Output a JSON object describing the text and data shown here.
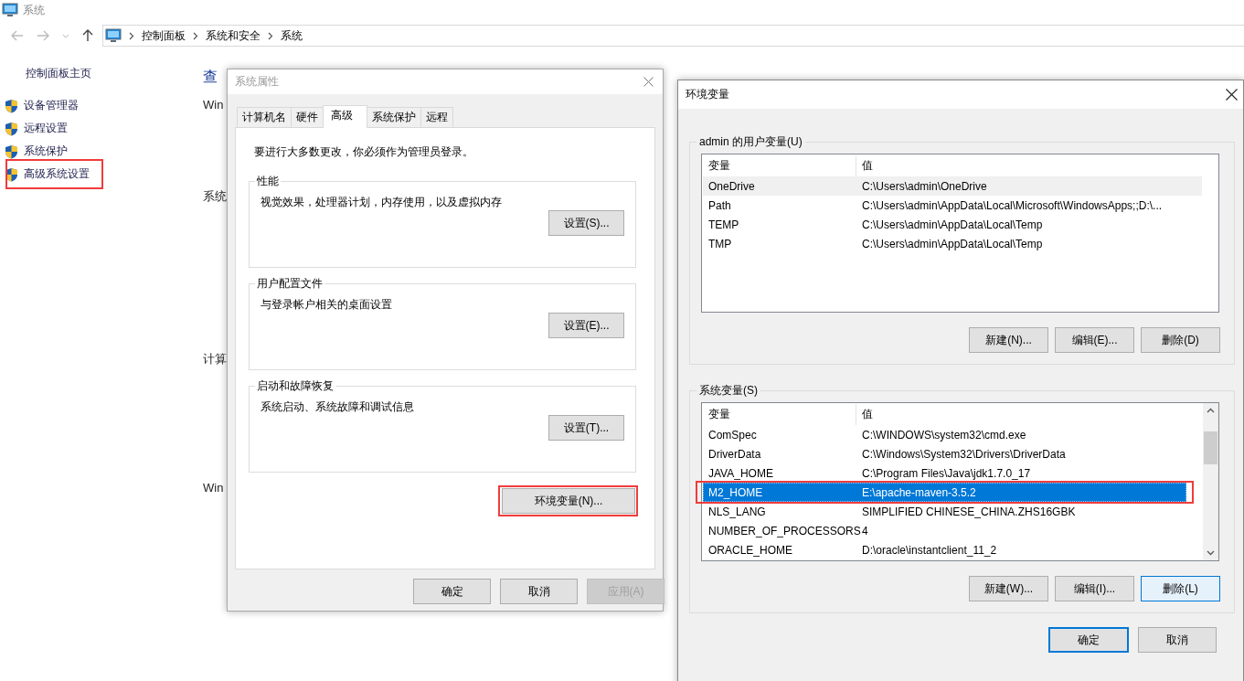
{
  "explorer": {
    "title": "系统",
    "breadcrumb": [
      "控制面板",
      "系统和安全",
      "系统"
    ],
    "sidebar": {
      "home": "控制面板主页",
      "items": [
        {
          "label": "设备管理器",
          "highlighted": false
        },
        {
          "label": "远程设置",
          "highlighted": false
        },
        {
          "label": "系统保护",
          "highlighted": false
        },
        {
          "label": "高级系统设置",
          "highlighted": true
        }
      ]
    },
    "content": [
      {
        "text": "查",
        "kind": "heading"
      },
      {
        "text": "Win",
        "kind": "section"
      },
      {
        "text": "系统",
        "kind": "section"
      },
      {
        "text": "计算",
        "kind": "section"
      },
      {
        "text": "Win",
        "kind": "section"
      }
    ]
  },
  "system_properties": {
    "title": "系统属性",
    "tabs": [
      {
        "label": "计算机名",
        "selected": false
      },
      {
        "label": "硬件",
        "selected": false
      },
      {
        "label": "高级",
        "selected": true
      },
      {
        "label": "系统保护",
        "selected": false
      },
      {
        "label": "远程",
        "selected": false
      }
    ],
    "notice": "要进行大多数更改，你必须作为管理员登录。",
    "groups": [
      {
        "title": "性能",
        "description": "视觉效果，处理器计划，内存使用，以及虚拟内存",
        "button": "设置(S)..."
      },
      {
        "title": "用户配置文件",
        "description": "与登录帐户相关的桌面设置",
        "button": "设置(E)..."
      },
      {
        "title": "启动和故障恢复",
        "description": "系统启动、系统故障和调试信息",
        "button": "设置(T)..."
      }
    ],
    "env_button": {
      "label": "环境变量(N)...",
      "highlighted": true
    },
    "buttons": [
      {
        "label": "确定",
        "disabled": false
      },
      {
        "label": "取消",
        "disabled": false
      },
      {
        "label": "应用(A)",
        "disabled": true
      }
    ]
  },
  "environment_variables": {
    "title": "环境变量",
    "lists": [
      {
        "title": "admin 的用户变量(U)",
        "focused": false,
        "scrollbar": false,
        "columns": [
          "变量",
          "值"
        ],
        "rows": [
          {
            "name": "OneDrive",
            "value": "C:\\Users\\admin\\OneDrive",
            "selected": true,
            "highlighted": false
          },
          {
            "name": "Path",
            "value": "C:\\Users\\admin\\AppData\\Local\\Microsoft\\WindowsApps;;D:\\...",
            "selected": false,
            "highlighted": false
          },
          {
            "name": "TEMP",
            "value": "C:\\Users\\admin\\AppData\\Local\\Temp",
            "selected": false,
            "highlighted": false
          },
          {
            "name": "TMP",
            "value": "C:\\Users\\admin\\AppData\\Local\\Temp",
            "selected": false,
            "highlighted": false
          }
        ],
        "buttons": [
          {
            "label": "新建(N)...",
            "hovered": false
          },
          {
            "label": "编辑(E)...",
            "hovered": false
          },
          {
            "label": "删除(D)",
            "hovered": false
          }
        ]
      },
      {
        "title": "系统变量(S)",
        "focused": true,
        "scrollbar": true,
        "columns": [
          "变量",
          "值"
        ],
        "rows": [
          {
            "name": "ComSpec",
            "value": "C:\\WINDOWS\\system32\\cmd.exe",
            "selected": false,
            "highlighted": false
          },
          {
            "name": "DriverData",
            "value": "C:\\Windows\\System32\\Drivers\\DriverData",
            "selected": false,
            "highlighted": false
          },
          {
            "name": "JAVA_HOME",
            "value": "C:\\Program Files\\Java\\jdk1.7.0_17",
            "selected": false,
            "highlighted": false
          },
          {
            "name": "M2_HOME",
            "value": "E:\\apache-maven-3.5.2",
            "selected": true,
            "highlighted": true
          },
          {
            "name": "NLS_LANG",
            "value": "SIMPLIFIED CHINESE_CHINA.ZHS16GBK",
            "selected": false,
            "highlighted": false
          },
          {
            "name": "NUMBER_OF_PROCESSORS",
            "value": "4",
            "selected": false,
            "highlighted": false
          },
          {
            "name": "ORACLE_HOME",
            "value": "D:\\oracle\\instantclient_11_2",
            "selected": false,
            "highlighted": false
          }
        ],
        "buttons": [
          {
            "label": "新建(W)...",
            "hovered": false
          },
          {
            "label": "编辑(I)...",
            "hovered": false
          },
          {
            "label": "删除(L)",
            "hovered": true
          }
        ]
      }
    ],
    "buttons": [
      {
        "label": "确定",
        "default": true
      },
      {
        "label": "取消",
        "default": false
      }
    ]
  }
}
